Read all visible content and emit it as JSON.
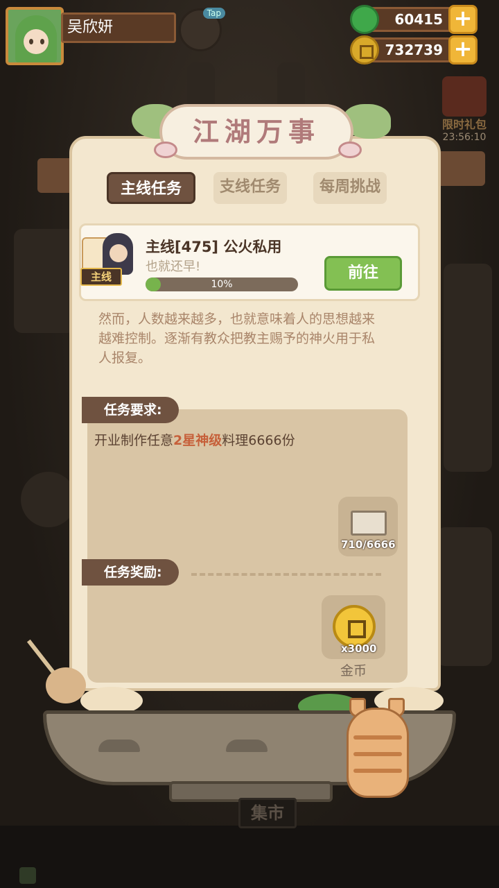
{
  "player": {
    "name": "吴欣妍"
  },
  "tap_badge": "Tap",
  "resources": [
    {
      "icon": "leaf-icon",
      "value": "60415"
    },
    {
      "icon": "coin-icon",
      "value": "732739"
    }
  ],
  "gift": {
    "label": "限时礼包",
    "timer": "23:56:10"
  },
  "panel": {
    "title": "江湖万事",
    "tabs": [
      {
        "label": "主线任务",
        "active": true
      },
      {
        "label": "支线任务",
        "active": false
      },
      {
        "label": "每周挑战",
        "active": false
      }
    ],
    "quest": {
      "tag": "主线",
      "title": "主线[475] 公火私用",
      "subtitle": "也就还早!",
      "progress_percent": 10,
      "progress_label": "10%",
      "go_label": "前往"
    },
    "description_lines": [
      "然而，人数越来越多，也就意味着人的思想越来",
      "越难控制。逐渐有教众把教主赐予的神火用于私",
      "人报复。"
    ],
    "requirement": {
      "label": "任务要求:",
      "text_before": "开业制作任意",
      "text_highlight": "2星神级",
      "text_after": "料理6666份",
      "item_count": "710/6666"
    },
    "reward": {
      "label": "任务奖励:",
      "count": "x3000",
      "name": "金币"
    }
  },
  "market_label": "集市",
  "colors": {
    "accent_green": "#83c053",
    "highlight_red": "#c6603a",
    "panel_bg": "#f3e7cf",
    "tab_active": "#6f5240"
  }
}
